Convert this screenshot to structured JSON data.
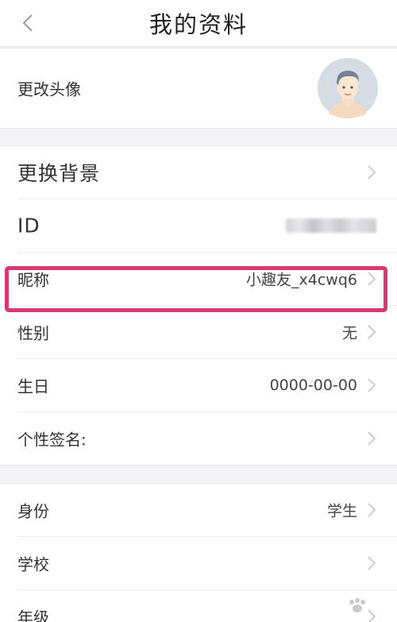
{
  "header": {
    "title": "我的资料"
  },
  "avatar_section": {
    "label": "更改头像"
  },
  "profile": {
    "background_label": "更换背景",
    "id_label": "ID",
    "nickname_label": "昵称",
    "nickname_value": "小趣友_x4cwq6",
    "gender_label": "性别",
    "gender_value": "无",
    "birthday_label": "生日",
    "birthday_value": "0000-00-00",
    "signature_label": "个性签名:"
  },
  "school_section": {
    "identity_label": "身份",
    "identity_value": "学生",
    "school_label": "学校",
    "grade_label": "年级"
  },
  "colors": {
    "highlight": "#d93873",
    "background": "#f4f4f6"
  }
}
